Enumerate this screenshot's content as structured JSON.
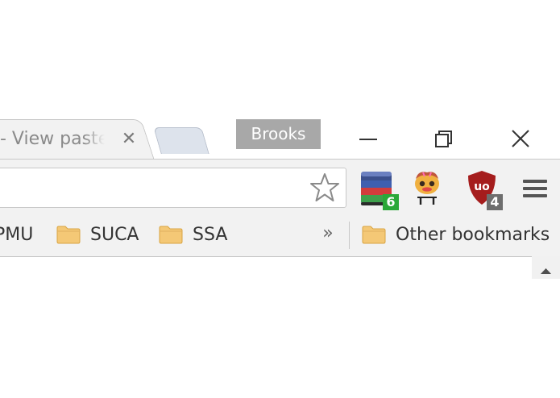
{
  "tab": {
    "title": "- View paste",
    "close_glyph": "✕"
  },
  "profile": {
    "name": "Brooks"
  },
  "extensions": {
    "wunderlist_badge": "6",
    "ublock_label": "uo",
    "ublock_badge": "4"
  },
  "bookmarks": {
    "items": [
      {
        "label": "PMU"
      },
      {
        "label": "SUCA"
      },
      {
        "label": "SSA"
      }
    ],
    "overflow_glyph": "»",
    "other_label": "Other bookmarks"
  },
  "colors": {
    "toolbar_bg": "#f2f2f2",
    "profile_bg": "#a8a8a8",
    "badge_green": "#2aa838",
    "badge_gray": "#6e6e6e",
    "ublock_red": "#a51d1d",
    "folder": "#f4c876"
  },
  "icons": {
    "star": "star-icon",
    "minimize": "minimize-icon",
    "restore": "restore-icon",
    "close": "close-icon",
    "menu": "hamburger-menu-icon",
    "folder": "folder-icon"
  }
}
